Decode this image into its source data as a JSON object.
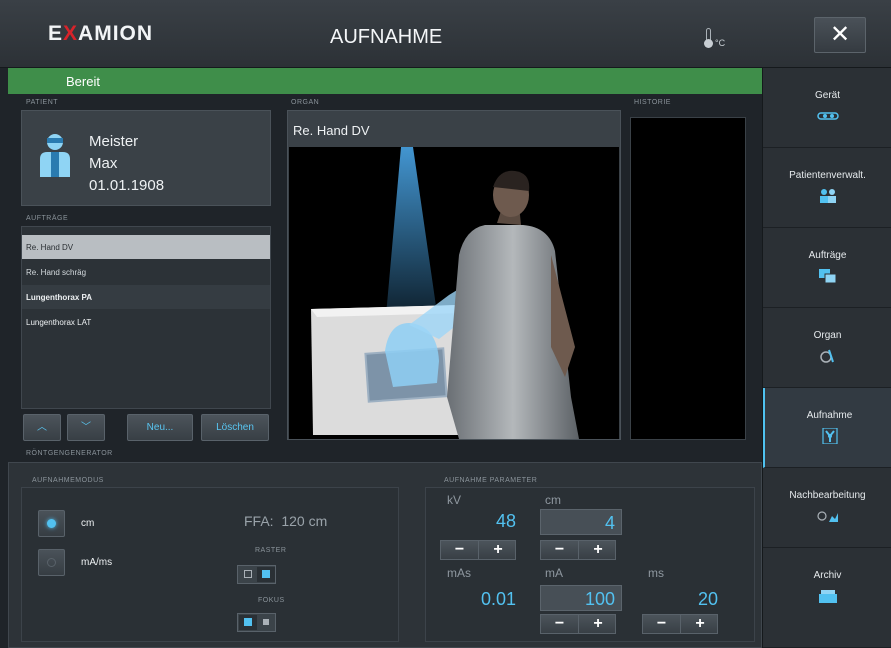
{
  "header": {
    "logo_left": "E",
    "logo_mark": "X",
    "logo_right": "AMION",
    "title": "AUFNAHME",
    "temp_unit": "°C",
    "close_label": "✕"
  },
  "status": {
    "text": "Bereit",
    "color": "#3f8e4a"
  },
  "patient": {
    "section_label": "PATIENT",
    "last_name": "Meister",
    "first_name": "Max",
    "birthdate": "01.01.1908"
  },
  "orders": {
    "section_label": "AUFTRÄGE",
    "items": [
      {
        "label": "Re. Hand DV"
      },
      {
        "label": "Re. Hand schräg"
      },
      {
        "label": "Lungenthorax PA"
      },
      {
        "label": "Lungenthorax LAT"
      }
    ],
    "buttons": {
      "up": "︿",
      "down": "﹀",
      "new": "Neu...",
      "delete": "Löschen"
    }
  },
  "organ": {
    "section_label": "ORGAN",
    "title": "Re. Hand DV"
  },
  "history": {
    "section_label": "HISTORIE"
  },
  "sidebar": {
    "items": [
      {
        "label": "Gerät",
        "icon": "device-icon"
      },
      {
        "label": "Patientenverwalt.",
        "icon": "patients-icon"
      },
      {
        "label": "Aufträge",
        "icon": "orders-icon"
      },
      {
        "label": "Organ",
        "icon": "organ-icon"
      },
      {
        "label": "Aufnahme",
        "icon": "radiation-icon"
      },
      {
        "label": "Nachbearbeitung",
        "icon": "postprocessing-icon"
      },
      {
        "label": "Archiv",
        "icon": "archive-icon"
      }
    ],
    "active_index": 4
  },
  "generator": {
    "section_label": "RÖNTGENGENERATOR",
    "mode_label": "AUFNAHMEMODUS",
    "modes": [
      {
        "label": "cm",
        "selected": true
      },
      {
        "label": "mA/ms",
        "selected": false
      }
    ],
    "ffa_label": "FFA:",
    "ffa_value": "120 cm",
    "raster_label": "RASTER",
    "fokus_label": "FOKUS",
    "params_label": "AUFNAHME PARAMETER",
    "kv": {
      "label": "kV",
      "value": "48"
    },
    "cm": {
      "label": "cm",
      "value": "4"
    },
    "mas": {
      "label": "mAs",
      "value": "0.01"
    },
    "ma": {
      "label": "mA",
      "value": "100"
    },
    "ms": {
      "label": "ms",
      "value": "20"
    },
    "minus": "−",
    "plus": "+",
    "accent": "#52c1f0"
  }
}
